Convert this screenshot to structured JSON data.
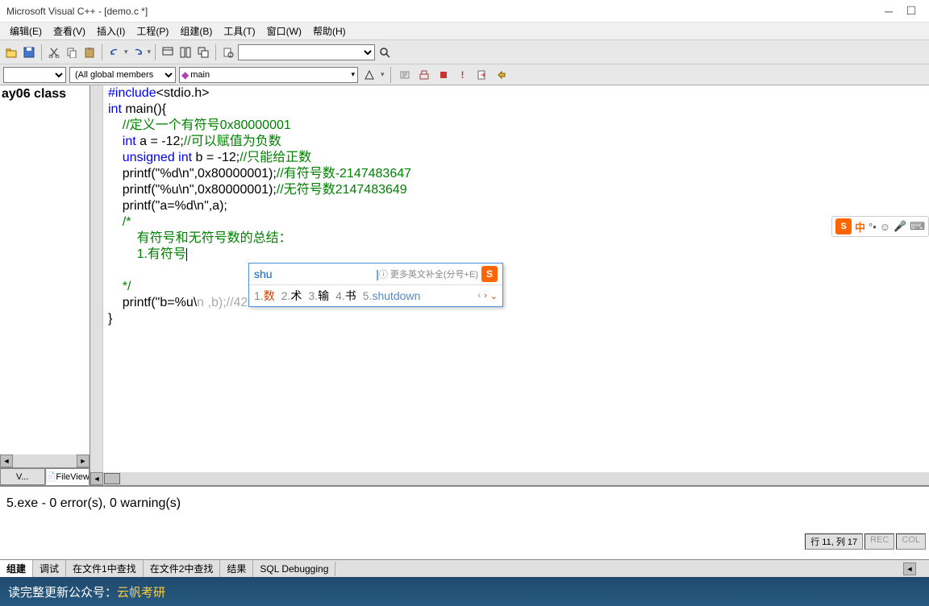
{
  "window": {
    "title": "Microsoft Visual C++ - [demo.c *]"
  },
  "menu": {
    "items": [
      "编辑(E)",
      "查看(V)",
      "插入(I)",
      "工程(P)",
      "组建(B)",
      "工具(T)",
      "窗口(W)",
      "帮助(H)"
    ]
  },
  "toolbar": {
    "combo1_width": 170,
    "combo2": "(All global members",
    "combo3": "main"
  },
  "sidebar": {
    "tree_item": "ay06 class",
    "tabs": {
      "a": "V...",
      "b": "FileView"
    }
  },
  "code": {
    "l1a": "#include",
    "l1b": "<stdio.h>",
    "l2a": "int",
    "l2b": " main(){",
    "l3": "    //定义一个有符号0x80000001",
    "l4a": "    int",
    "l4b": " a = -12;",
    "l4c": "//可以赋值为负数",
    "l5a": "    unsigned int",
    "l5b": " b = -12;",
    "l5c": "//只能给正数",
    "l6a": "    printf(\"%d\\n\",0x80000001);",
    "l6b": "//有符号数-2147483647",
    "l7a": "    printf(\"%u\\n\",0x80000001);",
    "l7b": "//无符号数2147483649",
    "l8": "    printf(\"a=%d\\n\",a);",
    "l9": "    /*",
    "l10": "        有符号和无符号数的总结：",
    "l11": "        1.有符号",
    "l12": "",
    "l13": "    */",
    "l14a": "    printf(\"b=%u\\",
    "l14b": "n ,b);//4294967284",
    "l15": "}"
  },
  "ime": {
    "input": "shu",
    "hint": "ⓘ 更多英文补全(分号+E)",
    "candidates": [
      {
        "n": "1.",
        "t": "数"
      },
      {
        "n": "2.",
        "t": "术"
      },
      {
        "n": "3.",
        "t": "输"
      },
      {
        "n": "4.",
        "t": "书"
      },
      {
        "n": "5.",
        "t": "shutdown"
      }
    ]
  },
  "output": {
    "text": "5.exe - 0 error(s), 0 warning(s)"
  },
  "output_tabs": [
    "组建",
    "调试",
    "在文件1中查找",
    "在文件2中查找",
    "结果",
    "SQL Debugging"
  ],
  "status": {
    "pos": "行 11, 列 17",
    "rec": "REC",
    "col": "COL"
  },
  "banner": {
    "prefix": "读完整更新公众号：",
    "highlight": "云帆考研"
  },
  "float": {
    "lang": "中"
  }
}
